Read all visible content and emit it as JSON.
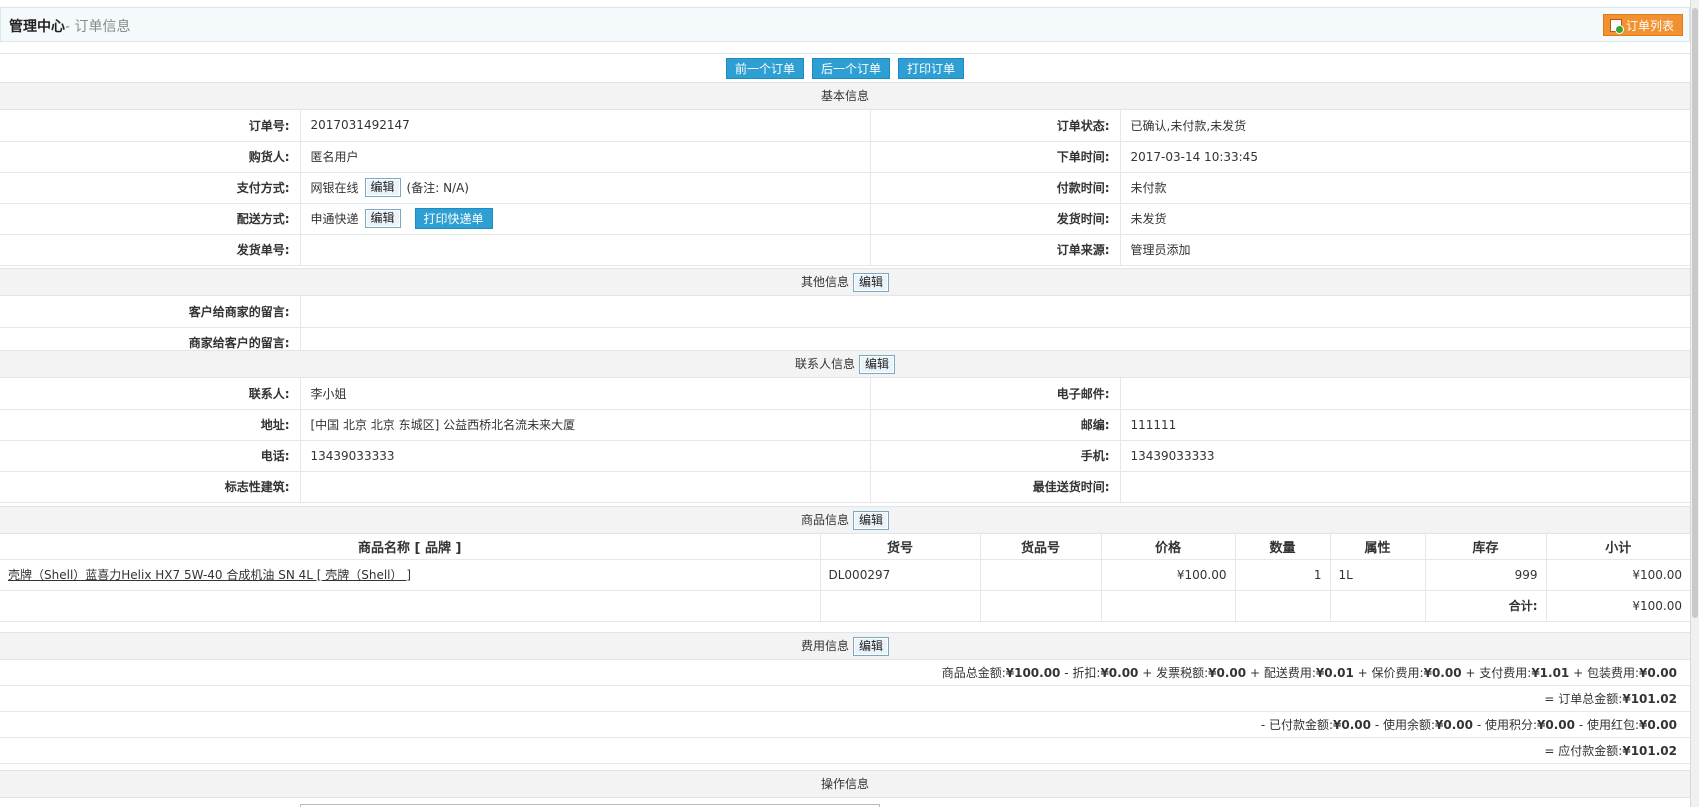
{
  "header": {
    "title_main": "管理中心",
    "title_sub": "- 订单信息",
    "list_button": "订单列表"
  },
  "nav": {
    "prev": "前一个订单",
    "next": "后一个订单",
    "print": "打印订单"
  },
  "basic": {
    "title": "基本信息",
    "order_no_label": "订单号:",
    "order_no": "2017031492147",
    "status_label": "订单状态:",
    "status": "已确认,未付款,未发货",
    "buyer_label": "购货人:",
    "buyer": "匿名用户",
    "order_time_label": "下单时间:",
    "order_time": "2017-03-14 10:33:45",
    "pay_method_label": "支付方式:",
    "pay_method": "网银在线",
    "pay_note": "(备注: N/A)",
    "pay_time_label": "付款时间:",
    "pay_time": "未付款",
    "ship_method_label": "配送方式:",
    "ship_method": "申通快递",
    "print_express": "打印快递单",
    "ship_time_label": "发货时间:",
    "ship_time": "未发货",
    "invoice_no_label": "发货单号:",
    "invoice_no": "",
    "source_label": "订单来源:",
    "source": "管理员添加",
    "edit": "编辑"
  },
  "other": {
    "title": "其他信息",
    "edit": "编辑",
    "to_seller_label": "客户给商家的留言:",
    "to_seller": "",
    "to_buyer_label": "商家给客户的留言:",
    "to_buyer": ""
  },
  "contact": {
    "title": "联系人信息",
    "edit": "编辑",
    "name_label": "联系人:",
    "name": "李小姐",
    "email_label": "电子邮件:",
    "email": "",
    "address_label": "地址:",
    "address": "[中国 北京 北京 东城区] 公益西桥北名流未来大厦",
    "zip_label": "邮编:",
    "zip": "111111",
    "tel_label": "电话:",
    "tel": "13439033333",
    "mobile_label": "手机:",
    "mobile": "13439033333",
    "landmark_label": "标志性建筑:",
    "landmark": "",
    "best_time_label": "最佳送货时间:",
    "best_time": ""
  },
  "goods": {
    "title": "商品信息",
    "edit": "编辑",
    "columns": [
      "商品名称 [ 品牌 ]",
      "货号",
      "货品号",
      "价格",
      "数量",
      "属性",
      "库存",
      "小计"
    ],
    "rows": [
      {
        "name": "壳牌（Shell）蓝喜力Helix HX7 5W-40 合成机油 SN 4L [ 壳牌（Shell） ]",
        "sn": "DL000297",
        "product_sn": "",
        "price": "¥100.00",
        "qty": "1",
        "attr": "1L",
        "stock": "999",
        "subtotal": "¥100.00"
      }
    ],
    "total_label": "合计:",
    "total": "¥100.00"
  },
  "fees": {
    "title": "费用信息",
    "edit": "编辑",
    "line1_pre": "商品总金额:",
    "goods_amount": "¥100.00",
    "discount_label": "- 折扣:",
    "discount": "¥0.00",
    "tax_label": "+ 发票税额:",
    "tax": "¥0.00",
    "ship_label": "+ 配送费用:",
    "ship": "¥0.01",
    "insure_label": "+ 保价费用:",
    "insure": "¥0.00",
    "payfee_label": "+ 支付费用:",
    "payfee": "¥1.01",
    "pack_label": "+ 包装费用:",
    "pack": "¥0.00",
    "order_total_label": "= 订单总金额:",
    "order_total": "¥101.02",
    "paid_label": "- 已付款金额:",
    "paid": "¥0.00",
    "surplus_label": "- 使用余额:",
    "surplus": "¥0.00",
    "integral_label": "- 使用积分:",
    "integral": "¥0.00",
    "bonus_label": "- 使用红包:",
    "bonus": "¥0.00",
    "due_label": "= 应付款金额:",
    "due": "¥101.02"
  },
  "operation": {
    "title": "操作信息"
  }
}
